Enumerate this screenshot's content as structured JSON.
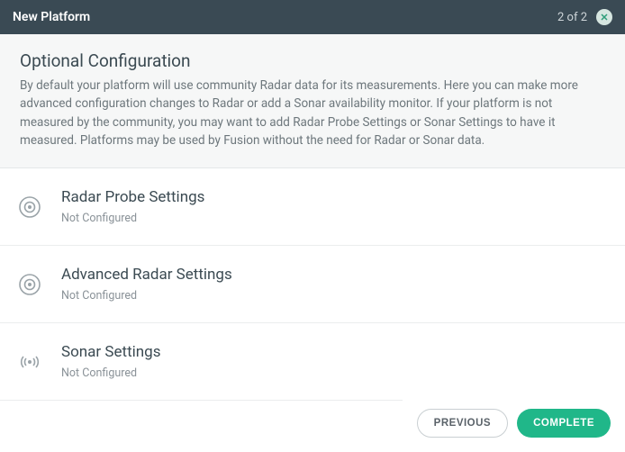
{
  "header": {
    "title": "New Platform",
    "step": "2 of 2"
  },
  "intro": {
    "heading": "Optional Configuration",
    "body": "By default your platform will use community Radar data for its measurements. Here you can make more advanced configuration changes to Radar or add a Sonar availability monitor. If your platform is not measured by the community, you may want to add Radar Probe Settings or Sonar Settings to have it measured. Platforms may be used by Fusion without the need for Radar or Sonar data."
  },
  "settings": [
    {
      "title": "Radar Probe Settings",
      "status": "Not Configured",
      "icon": "radar"
    },
    {
      "title": "Advanced Radar Settings",
      "status": "Not Configured",
      "icon": "radar"
    },
    {
      "title": "Sonar Settings",
      "status": "Not Configured",
      "icon": "sonar"
    }
  ],
  "footer": {
    "previous": "Previous",
    "complete": "Complete"
  }
}
